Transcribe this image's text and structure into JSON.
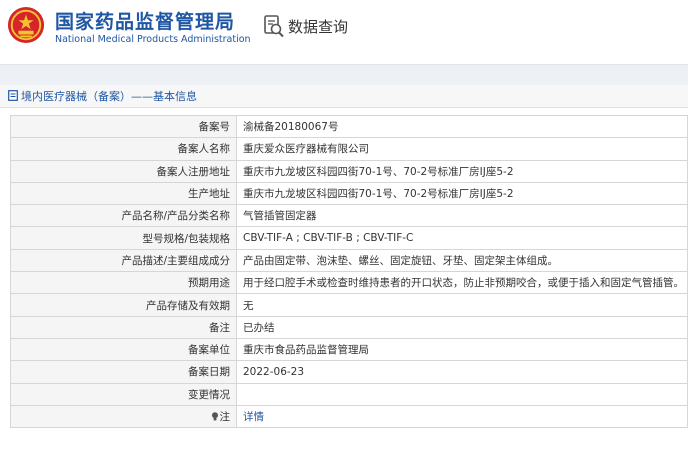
{
  "header": {
    "brand_cn": "国家药品监督管理局",
    "brand_en": "National Medical Products Administration",
    "search_title": "数据查询"
  },
  "breadcrumb": {
    "text": "境内医疗器械（备案）——基本信息"
  },
  "rows": [
    {
      "label": "备案号",
      "value": "渝械备20180067号"
    },
    {
      "label": "备案人名称",
      "value": "重庆爱众医疗器械有限公司"
    },
    {
      "label": "备案人注册地址",
      "value": "重庆市九龙坡区科园四街70-1号、70-2号标准厂房IJ座5-2"
    },
    {
      "label": "生产地址",
      "value": "重庆市九龙坡区科园四街70-1号、70-2号标准厂房IJ座5-2"
    },
    {
      "label": "产品名称/产品分类名称",
      "value": "气管插管固定器"
    },
    {
      "label": "型号规格/包装规格",
      "value": "CBV-TIF-A ; CBV-TIF-B ; CBV-TIF-C"
    },
    {
      "label": "产品描述/主要组成成分",
      "value": "产品由固定带、泡沫垫、螺丝、固定旋钮、牙垫、固定架主体组成。"
    },
    {
      "label": "预期用途",
      "value": "用于经口腔手术或检查时维持患者的开口状态，防止非预期咬合，或便于插入和固定气管插管。"
    },
    {
      "label": "产品存储及有效期",
      "value": "无"
    },
    {
      "label": "备注",
      "value": "已办结"
    },
    {
      "label": "备案单位",
      "value": "重庆市食品药品监督管理局"
    },
    {
      "label": "备案日期",
      "value": "2022-06-23"
    },
    {
      "label": "变更情况",
      "value": ""
    },
    {
      "label": "注",
      "value": "详情"
    }
  ],
  "colors": {
    "brand_blue": "#1f57a4",
    "emblem_red": "#d6242a",
    "emblem_gold": "#f2c230"
  },
  "icons": {
    "emblem": "national-emblem-icon",
    "search": "magnifier-document-icon",
    "breadcrumb": "document-icon",
    "note": "lightbulb-icon"
  }
}
